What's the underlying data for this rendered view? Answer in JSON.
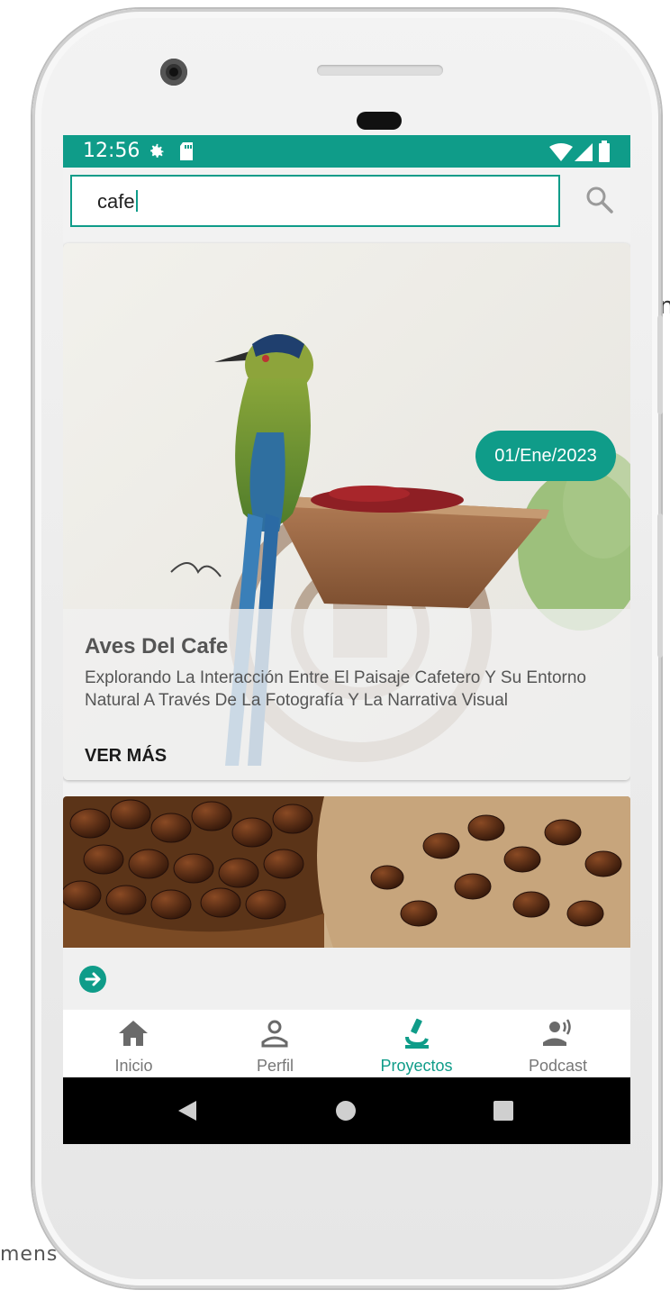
{
  "background": {
    "right_text": "n",
    "left_text": "mens"
  },
  "status_bar": {
    "time": "12:56",
    "icons": [
      "gear-icon",
      "sd-card-icon",
      "wifi-icon",
      "signal-icon",
      "battery-icon"
    ]
  },
  "search": {
    "value": "cafe",
    "button_icon": "search-icon"
  },
  "results": [
    {
      "date": "01/Ene/2023",
      "title": "Aves Del Cafe",
      "description": "Explorando La Interacción Entre El Paisaje Cafetero Y Su Entorno Natural A Través De La Fotografía Y La Narrativa Visual",
      "cta": "VER MÁS",
      "image": "bird-and-coffee-grinder-painting"
    },
    {
      "image": "coffee-beans-photo",
      "action_icon": "arrow-right-circle-icon"
    }
  ],
  "bottom_nav": {
    "items": [
      {
        "label": "Inicio",
        "icon": "home-icon"
      },
      {
        "label": "Perfil",
        "icon": "person-icon"
      },
      {
        "label": "Proyectos",
        "icon": "microscope-icon",
        "active": true
      },
      {
        "label": "Podcast",
        "icon": "speaker-icon"
      }
    ]
  },
  "system_nav": {
    "buttons": [
      "back-icon",
      "home-circle-icon",
      "recents-icon"
    ]
  },
  "colors": {
    "accent": "#0f9c89",
    "status_bar": "#0f9c89",
    "system_bar": "#000000"
  }
}
